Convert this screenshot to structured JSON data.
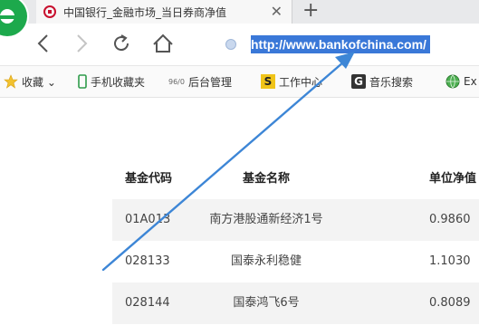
{
  "browser": {
    "logo_icon": "browser-logo-icon",
    "tab": {
      "title": "中国银行_金融市场_当日券商净值",
      "close": "✕",
      "favicon": "bank-of-china-favicon"
    },
    "new_tab": "+",
    "url": "http://www.bankofchina.com/",
    "accent": "#3a78d8"
  },
  "bookmarks": [
    {
      "label": "收藏 ⌄",
      "icon": "star-icon"
    },
    {
      "label": "手机收藏夹",
      "icon": "phone-icon"
    },
    {
      "label": "后台管理",
      "icon": "admin-icon",
      "prefix": "96/0"
    },
    {
      "label": "工作中心",
      "icon": "s-icon"
    },
    {
      "label": "音乐搜索",
      "icon": "g-icon"
    },
    {
      "label": "Ex",
      "icon": "globe-icon"
    }
  ],
  "table": {
    "headers": [
      "基金代码",
      "基金名称",
      "单位净值"
    ],
    "rows": [
      {
        "code": "01A013",
        "name": "南方港股通新经济1号",
        "nav": "0.9860"
      },
      {
        "code": "028133",
        "name": "国泰永利稳健",
        "nav": "1.1030"
      },
      {
        "code": "028144",
        "name": "国泰鸿飞6号",
        "nav": "0.8089"
      }
    ]
  },
  "annotation": {
    "color": "#3d86d6"
  }
}
